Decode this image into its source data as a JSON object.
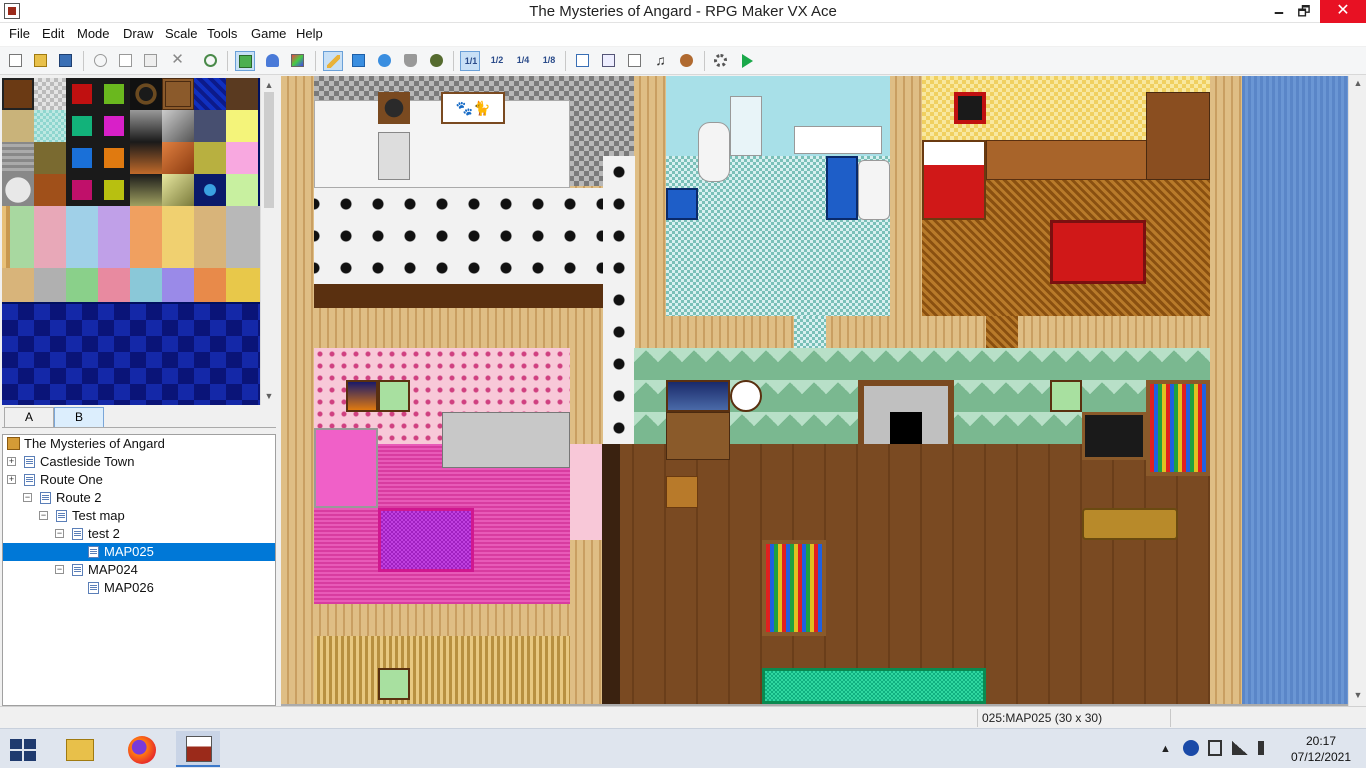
{
  "window": {
    "title": "The Mysteries of Angard - RPG Maker VX Ace",
    "minimize": "🗕",
    "maximize": "🗗",
    "close": "✕"
  },
  "menu": {
    "items": [
      "File",
      "Edit",
      "Mode",
      "Draw",
      "Scale",
      "Tools",
      "Game",
      "Help"
    ]
  },
  "toolbar": {
    "scale_labels": [
      "1/1",
      "1/2",
      "1/4",
      "1/8"
    ]
  },
  "tileset": {
    "tabs": [
      "A",
      "B"
    ],
    "selected_tab": "B"
  },
  "map_tree": {
    "items": [
      {
        "label": "The Mysteries of Angard",
        "level": 0,
        "expander": "",
        "type": "project"
      },
      {
        "label": "Castleside Town",
        "level": 1,
        "expander": "+",
        "type": "map"
      },
      {
        "label": "Route One",
        "level": 1,
        "expander": "+",
        "type": "map"
      },
      {
        "label": "Route 2",
        "level": 1,
        "expander": "−",
        "type": "map"
      },
      {
        "label": "Test map",
        "level": 2,
        "expander": "−",
        "type": "map"
      },
      {
        "label": "test 2",
        "level": 3,
        "expander": "−",
        "type": "map"
      },
      {
        "label": "MAP025",
        "level": 4,
        "expander": "",
        "type": "map",
        "selected": true
      },
      {
        "label": "MAP024",
        "level": 3,
        "expander": "−",
        "type": "map"
      },
      {
        "label": "MAP026",
        "level": 4,
        "expander": "",
        "type": "map"
      }
    ]
  },
  "status": {
    "map_info": "025:MAP025 (30 x 30)"
  },
  "taskbar": {
    "time": "20:17",
    "date": "07/12/2021"
  },
  "colors": {
    "accent": "#0078d7",
    "close": "#e81123",
    "wood_floor": "#7a4a22",
    "water": "#5a86c8",
    "pink_carpet": "#d83ca0",
    "green_rug": "#1fc48a"
  }
}
